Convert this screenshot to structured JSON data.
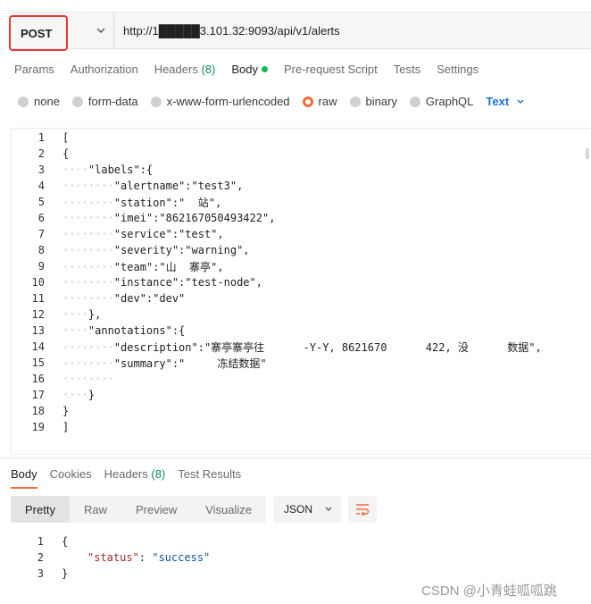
{
  "request": {
    "method": "POST",
    "url": "http://1█████3.101.32:9093/api/v1/alerts"
  },
  "request_tabs": [
    {
      "label": "Params"
    },
    {
      "label": "Authorization"
    },
    {
      "label": "Headers",
      "count": "(8)"
    },
    {
      "label": "Body",
      "active": true
    },
    {
      "label": "Pre-request Script"
    },
    {
      "label": "Tests"
    },
    {
      "label": "Settings"
    }
  ],
  "body_types": [
    {
      "label": "none"
    },
    {
      "label": "form-data"
    },
    {
      "label": "x-www-form-urlencoded"
    },
    {
      "label": "raw",
      "checked": true
    },
    {
      "label": "binary"
    },
    {
      "label": "GraphQL"
    }
  ],
  "format_dropdown": "Text",
  "editor_lines": [
    {
      "n": "1",
      "ws": "",
      "text": "["
    },
    {
      "n": "2",
      "ws": "",
      "text": "{"
    },
    {
      "n": "3",
      "ws": "····",
      "text": "\"labels\":{"
    },
    {
      "n": "4",
      "ws": "········",
      "text": "\"alertname\":\"test3\","
    },
    {
      "n": "5",
      "ws": "········",
      "text": "\"station\":\"  站\","
    },
    {
      "n": "6",
      "ws": "········",
      "text": "\"imei\":\"862167050493422\","
    },
    {
      "n": "7",
      "ws": "········",
      "text": "\"service\":\"test\","
    },
    {
      "n": "8",
      "ws": "········",
      "text": "\"severity\":\"warning\","
    },
    {
      "n": "9",
      "ws": "········",
      "text": "\"team\":\"山  寨亭\","
    },
    {
      "n": "10",
      "ws": "········",
      "text": "\"instance\":\"test-node\","
    },
    {
      "n": "11",
      "ws": "········",
      "text": "\"dev\":\"dev\""
    },
    {
      "n": "12",
      "ws": "····",
      "text": "},"
    },
    {
      "n": "13",
      "ws": "····",
      "text": "\"annotations\":{"
    },
    {
      "n": "14",
      "ws": "········",
      "text": "\"description\":\"寨亭寨亭往      -Y-Y, 8621670      422, 没      数据\","
    },
    {
      "n": "15",
      "ws": "········",
      "text": "\"summary\":\"     冻结数据\""
    },
    {
      "n": "16",
      "ws": "········",
      "text": ""
    },
    {
      "n": "17",
      "ws": "····",
      "text": "}"
    },
    {
      "n": "18",
      "ws": "",
      "text": "}"
    },
    {
      "n": "19",
      "ws": "",
      "text": "]"
    }
  ],
  "response_tabs": [
    {
      "label": "Body",
      "active": true
    },
    {
      "label": "Cookies"
    },
    {
      "label": "Headers",
      "count": "(8)"
    },
    {
      "label": "Test Results"
    }
  ],
  "view_modes": [
    "Pretty",
    "Raw",
    "Preview",
    "Visualize"
  ],
  "response_format": "JSON",
  "response_lines": [
    {
      "n": "1",
      "text": "{"
    },
    {
      "n": "2",
      "key": "\"status\"",
      "value": "\"success\""
    },
    {
      "n": "3",
      "text": "}"
    }
  ],
  "watermark": "CSDN @小青蛙呱呱跳",
  "colors": {
    "method_highlight": "#e53935",
    "accent": "#f26b3a",
    "link": "#1a73d9",
    "green": "#0cbb52"
  }
}
